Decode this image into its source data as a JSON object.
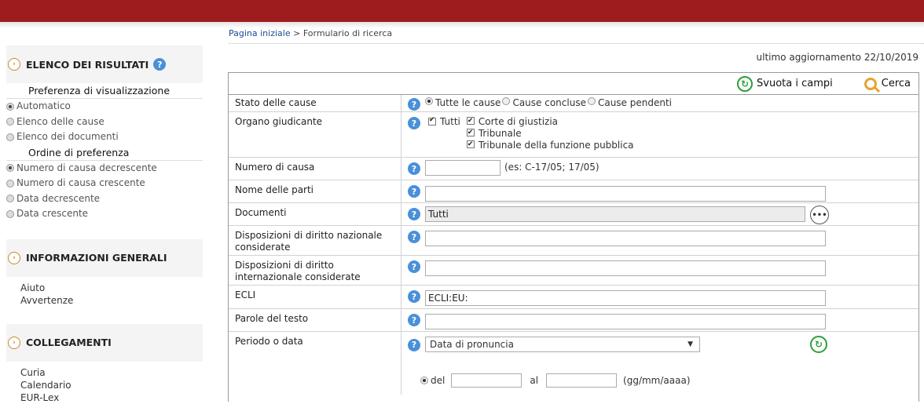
{
  "breadcrumb": {
    "home": "Pagina iniziale",
    "sep": " > ",
    "current": "Formulario di ricerca"
  },
  "last_update": "ultimo aggiornamento 22/10/2019",
  "sidebar": {
    "results_title": "ELENCO DEI RISULTATI",
    "display_pref_title": "Preferenza di visualizzazione",
    "display_options": [
      {
        "label": "Automatico",
        "selected": true
      },
      {
        "label": "Elenco delle cause",
        "selected": false
      },
      {
        "label": "Elenco dei documenti",
        "selected": false
      }
    ],
    "order_title": "Ordine di preferenza",
    "order_options": [
      {
        "label": "Numero di causa decrescente",
        "selected": true
      },
      {
        "label": "Numero di causa crescente",
        "selected": false
      },
      {
        "label": "Data decrescente",
        "selected": false
      },
      {
        "label": "Data crescente",
        "selected": false
      }
    ],
    "general_title": "INFORMAZIONI GENERALI",
    "general_links": [
      "Aiuto",
      "Avvertenze"
    ],
    "links_title": "COLLEGAMENTI",
    "links": [
      "Curia",
      "Calendario",
      "EUR-Lex"
    ]
  },
  "actions": {
    "reset_label": "Svuota i campi",
    "search_label": "Cerca"
  },
  "form": {
    "stato": {
      "label": "Stato delle cause",
      "options": [
        "Tutte le cause",
        "Cause concluse",
        "Cause pendenti"
      ]
    },
    "organo": {
      "label": "Organo giudicante",
      "all": "Tutti",
      "options": [
        "Corte di giustizia",
        "Tribunale",
        "Tribunale della funzione pubblica"
      ]
    },
    "numero": {
      "label": "Numero di causa",
      "hint": "(es: C-17/05; 17/05)",
      "value": ""
    },
    "nome": {
      "label": "Nome delle parti",
      "value": ""
    },
    "documenti": {
      "label": "Documenti",
      "value": "Tutti"
    },
    "disp_naz": {
      "label": "Disposizioni di diritto nazionale considerate",
      "value": ""
    },
    "disp_int": {
      "label": "Disposizioni di diritto internazionale considerate",
      "value": ""
    },
    "ecli": {
      "label": "ECLI",
      "value": "ECLI:EU:"
    },
    "parole": {
      "label": "Parole del testo",
      "value": ""
    },
    "periodo": {
      "label": "Periodo o data",
      "selected": "Data di pronuncia",
      "from_label": "del",
      "to_label": "al",
      "format": "(gg/mm/aaaa)"
    }
  },
  "colors": {
    "topbar": "#9e1c1e",
    "link": "#1b4d8f",
    "help": "#4a90d9",
    "accent": "#c98a2c",
    "reset": "#2e9e3a",
    "search": "#e8a230"
  }
}
